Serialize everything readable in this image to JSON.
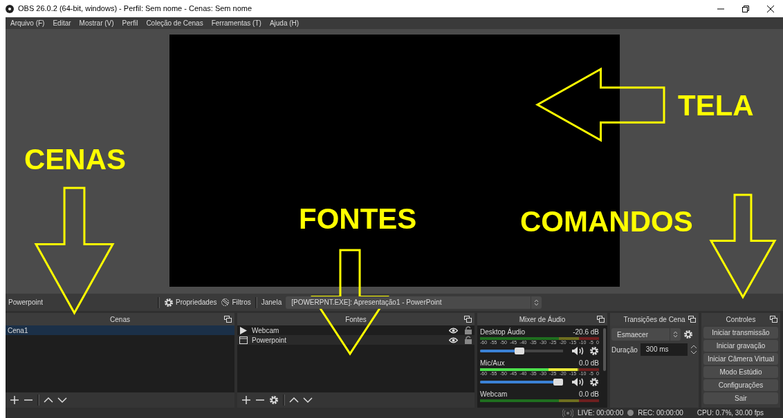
{
  "window": {
    "title": "OBS 26.0.2 (64-bit, windows) - Perfil: Sem nome - Cenas: Sem nome"
  },
  "menu": [
    "Arquivo (F)",
    "Editar",
    "Mostrar (V)",
    "Perfil",
    "Coleção de Cenas",
    "Ferramentas (T)",
    "Ajuda (H)"
  ],
  "source_toolbar": {
    "source_name": "Powerpoint",
    "properties": "Propriedades",
    "filters": "Filtros",
    "window_label": "Janela",
    "window_value": "[POWERPNT.EXE]: Apresentação1 - PowerPoint"
  },
  "scenes": {
    "title": "Cenas",
    "items": [
      {
        "name": "Cena1",
        "selected": true
      }
    ]
  },
  "sources": {
    "title": "Fontes",
    "items": [
      {
        "kind": "media",
        "name": "Webcam",
        "visible": true,
        "locked": false
      },
      {
        "kind": "window",
        "name": "Powerpoint",
        "visible": true,
        "locked": false
      }
    ]
  },
  "mixer": {
    "title": "Mixer de Áudio",
    "channels": [
      {
        "name": "Desktop Áudio",
        "reading": "-20.6 dB",
        "scale": [
          "-60",
          "-55",
          "-50",
          "-45",
          "-40",
          "-35",
          "-30",
          "-25",
          "-20",
          "-15",
          "-10",
          "-5",
          "0"
        ],
        "volume": {
          "level": 0.47
        }
      },
      {
        "name": "Mic/Aux",
        "reading": "0.0 dB",
        "meter": {
          "level": 0.82
        },
        "scale": [
          "-60",
          "-55",
          "-50",
          "-45",
          "-40",
          "-35",
          "-30",
          "-25",
          "-20",
          "-15",
          "-10",
          "-5",
          "0"
        ],
        "volume": {
          "level": 1
        }
      },
      {
        "name": "Webcam",
        "reading": "0.0 dB"
      }
    ]
  },
  "transitions": {
    "title": "Transições de Cena",
    "transition": "Esmaecer",
    "duration_label": "Duração",
    "duration": "300 ms"
  },
  "controls": {
    "title": "Controles",
    "buttons": [
      "Iniciar transmissão",
      "Iniciar gravação",
      "Iniciar Câmera Virtual",
      "Modo Estúdio",
      "Configurações",
      "Sair"
    ]
  },
  "status": {
    "live": "LIVE: 00:00:00",
    "rec": "REC: 00:00:00",
    "cpu": "CPU: 0.7%, 30.00 fps"
  },
  "annotations": [
    {
      "text": "TELA",
      "kind": "left"
    },
    {
      "text": "CENAS",
      "kind": "down"
    },
    {
      "text": "FONTES",
      "kind": "down"
    },
    {
      "text": "COMANDOS",
      "kind": "down"
    }
  ]
}
